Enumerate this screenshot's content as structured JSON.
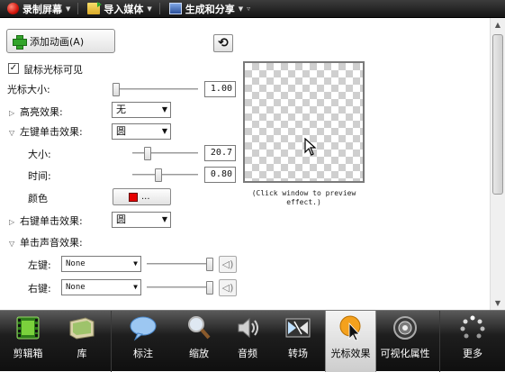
{
  "toolbar": {
    "record": "录制屏幕",
    "import": "导入媒体",
    "share": "生成和分享"
  },
  "panel": {
    "add_animation": "添加动画(A)",
    "cursor_visible": "鼠标光标可见",
    "cursor_visible_checked": true,
    "cursor_size_label": "光标大小:",
    "cursor_size_value": "1.00",
    "cursor_size_level": 0.0,
    "highlight_label": "高亮效果:",
    "highlight_value": "无",
    "left_click_label": "左键单击效果:",
    "left_click_value": "圆",
    "size_label": "大小:",
    "size_value": "20.7",
    "size_level": 0.2,
    "time_label": "时间:",
    "time_value": "0.80",
    "time_level": 0.38,
    "color_label": "颜色",
    "color_button": "...",
    "color_value": "#e60000",
    "right_click_label": "右键单击效果:",
    "right_click_value": "圆",
    "sound_label": "单击声音效果:",
    "left_key_label": "左键:",
    "left_key_value": "None",
    "right_key_label": "右键:",
    "right_key_value": "None",
    "preview_note": "(Click window to preview effect.)"
  },
  "tabs": [
    {
      "label": "剪辑箱",
      "icon": "film-icon"
    },
    {
      "label": "库",
      "icon": "library-icon"
    },
    {
      "label": "标注",
      "icon": "callout-icon"
    },
    {
      "label": "缩放",
      "icon": "zoom-icon"
    },
    {
      "label": "音频",
      "icon": "audio-icon"
    },
    {
      "label": "转场",
      "icon": "transition-icon"
    },
    {
      "label": "光标效果",
      "icon": "cursor-effect-icon",
      "active": true
    },
    {
      "label": "可视化属性",
      "icon": "visual-properties-icon"
    },
    {
      "label": "更多",
      "icon": "more-icon"
    }
  ]
}
